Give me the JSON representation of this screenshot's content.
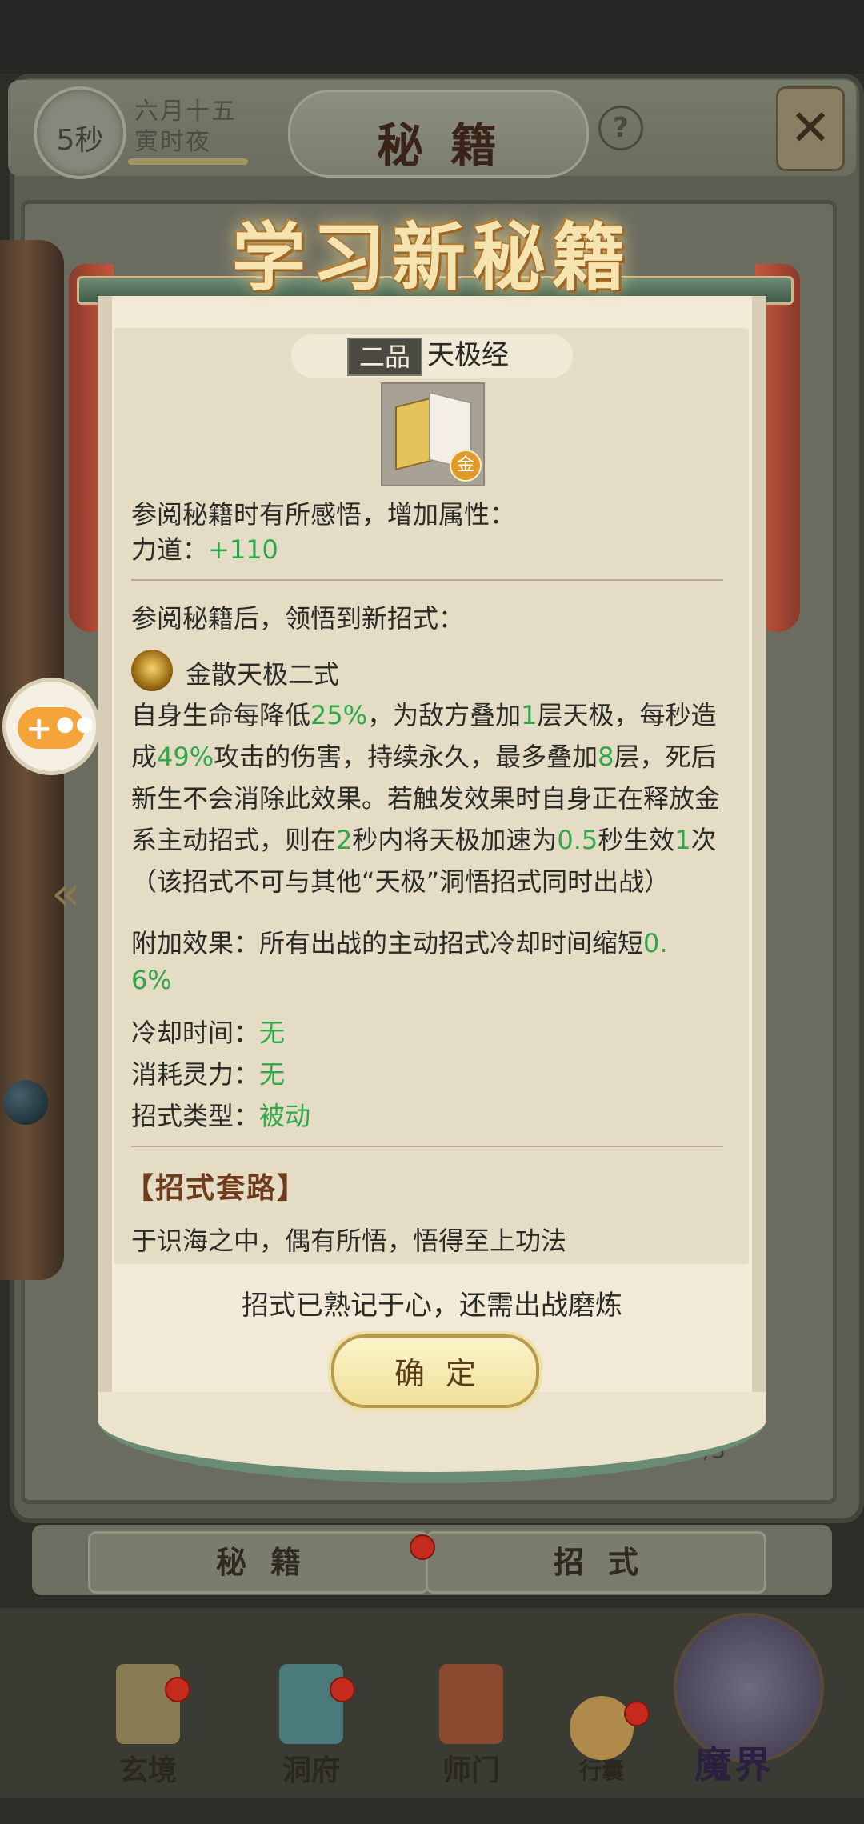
{
  "header": {
    "timer": "5秒",
    "date_line1": "六月十五",
    "date_line2": "寅时夜",
    "title": "秘籍",
    "help_symbol": "?"
  },
  "dialog": {
    "headline": "学习新秘籍",
    "grade": "二品",
    "book_name": "天极经",
    "badge": "金",
    "intro": "参阅秘籍时有所感悟，增加属性：",
    "stat_label": "力道：",
    "stat_value": "+110",
    "learn_line": "参阅秘籍后，领悟到新招式：",
    "skill_name": "金散天极二式",
    "desc": [
      {
        "t": "自身生命每降低"
      },
      {
        "g": "25%"
      },
      {
        "t": "，为敌方叠加"
      },
      {
        "g": "1"
      },
      {
        "t": "层天极，每秒造成"
      },
      {
        "g": "49%"
      },
      {
        "t": "攻击的伤害，持续永久，最多叠加"
      },
      {
        "g": "8"
      },
      {
        "t": "层，死后新生不会消除此效果。若触发效果时自身正在释放金系主动招式，则在"
      },
      {
        "g": "2"
      },
      {
        "t": "秒内将天极加速为"
      },
      {
        "g": "0.5"
      },
      {
        "t": "秒生效"
      },
      {
        "g": "1"
      },
      {
        "t": "次（该招式不可与其他“天极”洞悟招式同时出战）"
      }
    ],
    "extra_label": "附加效果：所有出战的主动招式冷却时间缩短",
    "extra_value_1": "0.",
    "extra_value_2": "6%",
    "cooldown_label": "冷却时间：",
    "cooldown_value": "无",
    "cost_label": "消耗灵力：",
    "cost_value": "无",
    "type_label": "招式类型：",
    "type_value": "被动",
    "section_title": "【招式套路】",
    "section_text": "于识海之中，偶有所悟，悟得至上功法",
    "hint": "招式已熟记于心，还需出战磨炼",
    "confirm": "确定"
  },
  "page_count": "3/3",
  "tabs": [
    "秘籍",
    "招式"
  ],
  "bottom_nav": [
    "玄境",
    "洞府",
    "师门",
    "行囊",
    "魔界"
  ]
}
